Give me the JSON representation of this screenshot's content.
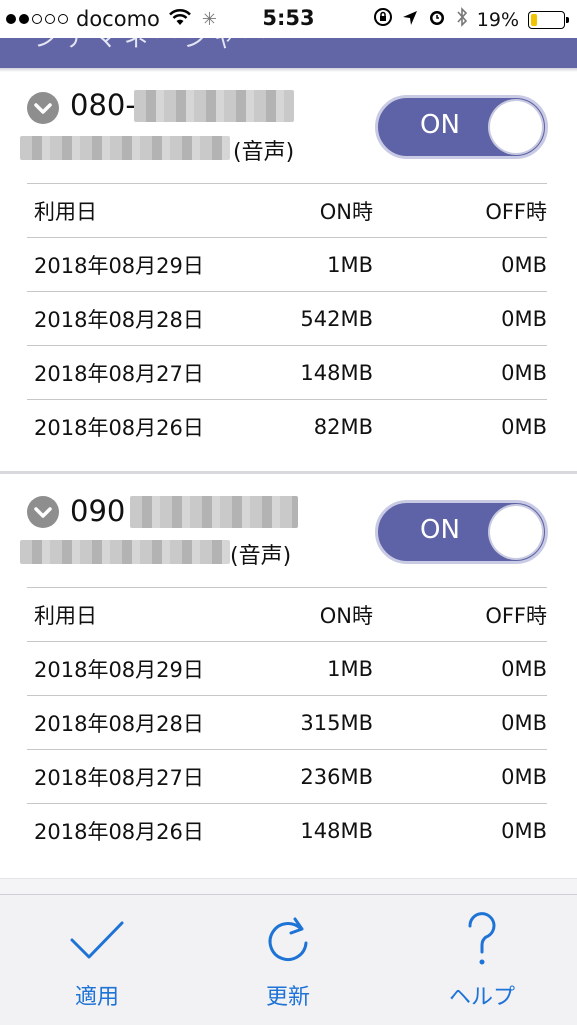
{
  "status_bar": {
    "carrier": "docomo",
    "time": "5:53",
    "battery": "19%",
    "battery_fraction": 0.19,
    "signal_strength": 2,
    "signal_total": 5,
    "icons": [
      "wifi-icon",
      "activity-spinner-icon",
      "rotation-lock-icon",
      "location-arrow-icon",
      "alarm-icon",
      "bluetooth-icon",
      "battery-icon"
    ]
  },
  "header": {
    "title": "シテマネージャー"
  },
  "lines": [
    {
      "number": "080-",
      "voice_suffix": "(音声)",
      "toggle_label": "ON",
      "table": {
        "headers": [
          "利用日",
          "ON時",
          "OFF時"
        ],
        "rows": [
          [
            "2018年08月29日",
            "1MB",
            "0MB"
          ],
          [
            "2018年08月28日",
            "542MB",
            "0MB"
          ],
          [
            "2018年08月27日",
            "148MB",
            "0MB"
          ],
          [
            "2018年08月26日",
            "82MB",
            "0MB"
          ]
        ]
      }
    },
    {
      "number": "090",
      "voice_suffix": "(音声)",
      "toggle_label": "ON",
      "table": {
        "headers": [
          "利用日",
          "ON時",
          "OFF時"
        ],
        "rows": [
          [
            "2018年08月29日",
            "1MB",
            "0MB"
          ],
          [
            "2018年08月28日",
            "315MB",
            "0MB"
          ],
          [
            "2018年08月27日",
            "236MB",
            "0MB"
          ],
          [
            "2018年08月26日",
            "148MB",
            "0MB"
          ]
        ]
      }
    }
  ],
  "toolbar": {
    "apply_label": "適用",
    "refresh_label": "更新",
    "help_label": "ヘルプ"
  },
  "colors": {
    "accent": "#5e62a6",
    "header": "#6366a6",
    "toolbar_tint": "#1e73d6",
    "battery_low": "#f2c300"
  }
}
